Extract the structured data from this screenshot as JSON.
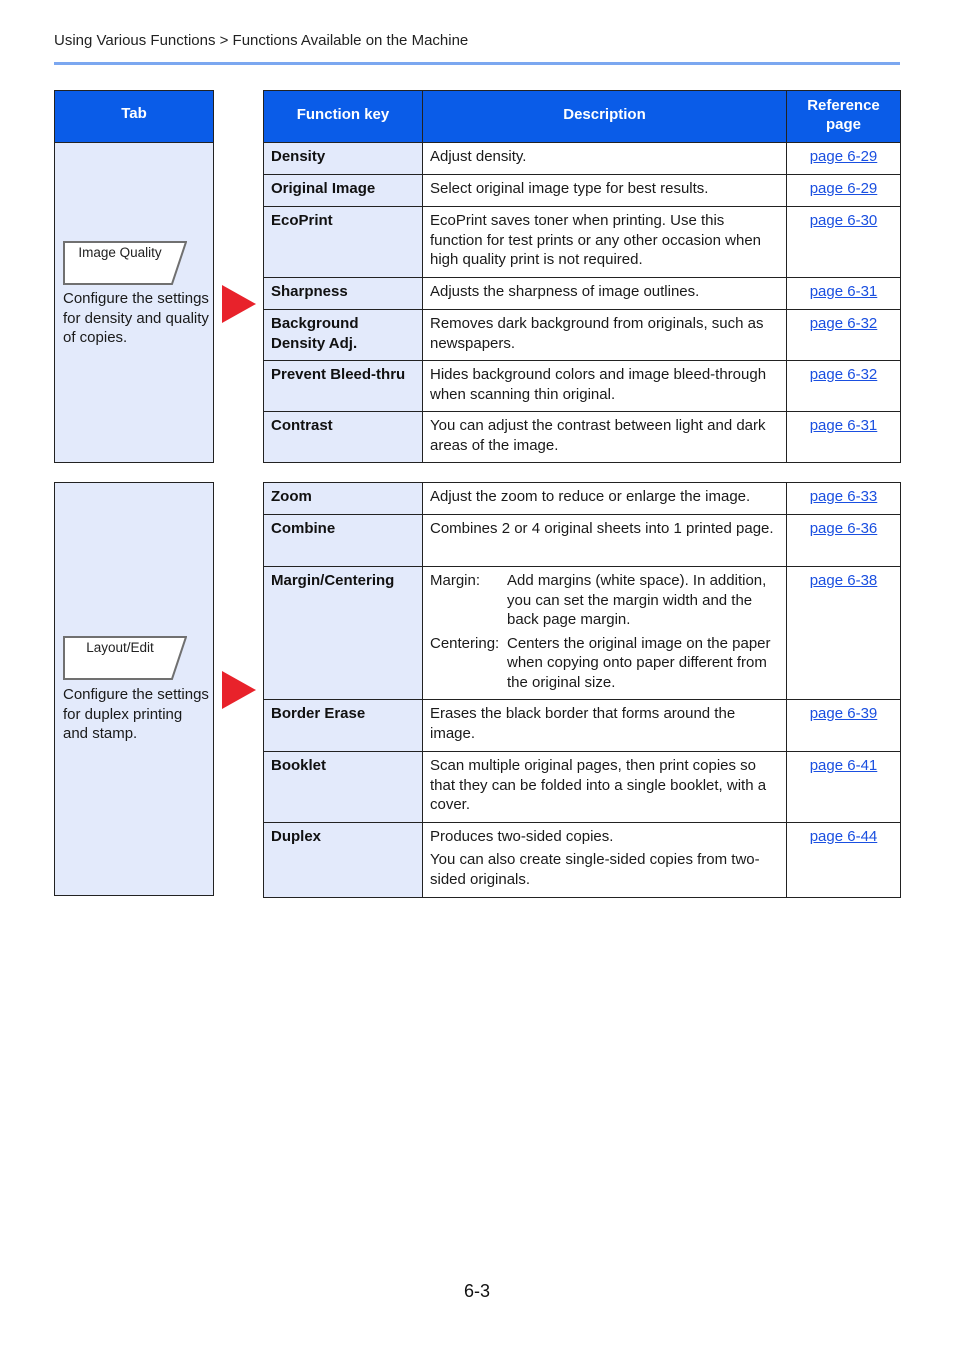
{
  "header": {
    "breadcrumb": "Using Various Functions > Functions Available on the Machine"
  },
  "columns": {
    "tab": "Tab",
    "function_key": "Function key",
    "description": "Description",
    "reference_page": "Reference page"
  },
  "sections": [
    {
      "tab_key_label": "Image Quality",
      "tab_description": "Configure the settings for density and quality of copies.",
      "rows": [
        {
          "key": "Density",
          "description": [
            "Adjust density."
          ],
          "ref": "page 6-29"
        },
        {
          "key": "Original Image",
          "description": [
            "Select original image type for best results."
          ],
          "ref": "page 6-29"
        },
        {
          "key": "EcoPrint",
          "description": [
            "EcoPrint saves toner when printing. Use this function for test prints or any other occasion when high quality print is not required."
          ],
          "ref": "page 6-30"
        },
        {
          "key": "Sharpness",
          "description": [
            "Adjusts the sharpness of image outlines."
          ],
          "ref": "page 6-31"
        },
        {
          "key": "Background Density Adj.",
          "description": [
            "Removes dark background from originals, such as newspapers."
          ],
          "ref": "page 6-32"
        },
        {
          "key": "Prevent Bleed-thru",
          "description": [
            "Hides background colors and image bleed-through when scanning thin original."
          ],
          "ref": "page 6-32"
        },
        {
          "key": "Contrast",
          "description": [
            "You can adjust the contrast between light and dark areas of the image."
          ],
          "ref": "page 6-31"
        }
      ]
    },
    {
      "tab_key_label": "Layout/Edit",
      "tab_description": "Configure the settings for duplex printing and stamp.",
      "rows": [
        {
          "key": "Zoom",
          "description": [
            "Adjust the zoom to reduce or enlarge the image."
          ],
          "ref": "page 6-33"
        },
        {
          "key": "Combine",
          "description": [
            "Combines 2 or 4 original sheets into 1 printed page."
          ],
          "ref": "page 6-36"
        },
        {
          "key": "Margin/Centering",
          "sub_items": [
            {
              "label": "Margin:",
              "text": "Add margins (white space). In addition, you can set the margin width and the back page margin."
            },
            {
              "label": "Centering:",
              "text": "Centers the original image on the paper when copying onto paper different from the original size."
            }
          ],
          "ref": "page 6-38"
        },
        {
          "key": "Border Erase",
          "description": [
            "Erases the black border that forms around the image."
          ],
          "ref": "page 6-39"
        },
        {
          "key": "Booklet",
          "description": [
            "Scan multiple original pages, then print copies so that they can be folded into a single booklet, with a cover."
          ],
          "ref": "page 6-41"
        },
        {
          "key": "Duplex",
          "description": [
            "Produces two-sided copies.",
            "You can also create single-sided copies from two-sided originals."
          ],
          "ref": "page 6-44"
        }
      ]
    }
  ],
  "footer": {
    "page_number": "6-3"
  },
  "colors": {
    "header_blue": "#0a5ce8",
    "key_cell_bg": "#e3eafb",
    "link_blue": "#1a4fe0",
    "arrow_red": "#e8222b",
    "rule_blue": "#7ba7f0"
  }
}
